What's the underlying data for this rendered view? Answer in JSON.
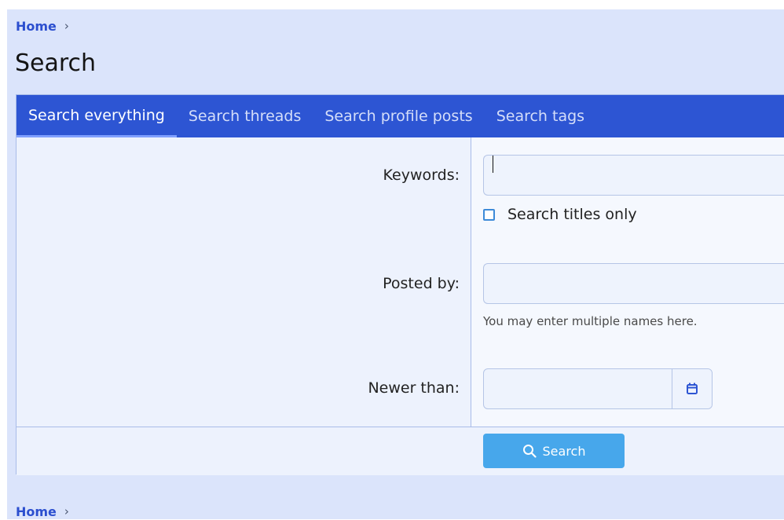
{
  "breadcrumb_top": {
    "label": "Home",
    "separator": "›"
  },
  "page": {
    "title": "Search"
  },
  "tabs": [
    {
      "label": "Search everything",
      "active": true
    },
    {
      "label": "Search threads",
      "active": false
    },
    {
      "label": "Search profile posts",
      "active": false
    },
    {
      "label": "Search tags",
      "active": false
    }
  ],
  "form": {
    "keywords": {
      "label": "Keywords:",
      "value": "",
      "placeholder": ""
    },
    "titles_only": {
      "label": "Search titles only",
      "checked": false
    },
    "posted_by": {
      "label": "Posted by:",
      "value": "",
      "placeholder": "",
      "hint": "You may enter multiple names here."
    },
    "newer_than": {
      "label": "Newer than:",
      "value": "",
      "placeholder": "",
      "icon": "calendar-icon"
    }
  },
  "submit": {
    "label": "Search",
    "icon": "search-icon"
  },
  "breadcrumb_bottom": {
    "label": "Home",
    "separator": "›"
  },
  "colors": {
    "background": "#dbe4fb",
    "tab_bar": "#2d55d3",
    "primary_button": "#47a7eb",
    "link": "#2c4fcf",
    "checkbox_border": "#3d8ad8"
  }
}
